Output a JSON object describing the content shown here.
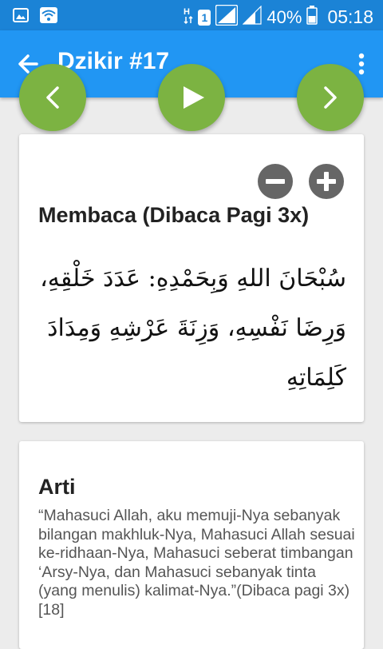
{
  "status_bar": {
    "sim_slot": "1",
    "battery_percent": "40%",
    "time": "05:18",
    "icons": [
      "image-icon",
      "wifi-icon",
      "data-icon",
      "sim-badge",
      "signal-icon",
      "signal-icon",
      "battery-icon"
    ]
  },
  "app_bar": {
    "title": "Dzikir #17",
    "back_icon": "arrow-back-icon",
    "menu_icon": "more-vert-icon"
  },
  "nav": {
    "prev_icon": "chevron-left-icon",
    "play_icon": "play-icon",
    "next_icon": "chevron-right-icon"
  },
  "reading_card": {
    "heading": "Membaca (Dibaca Pagi 3x)",
    "arabic": "سُبْحَانَ اللهِ وَبِحَمْدِهِ: عَدَدَ خَلْقِهِ، وَرِضَا نَفْسِهِ، وَزِنَةَ عَرْشِهِ وَمِدَادَ كَلِمَاتِهِ",
    "zoom_out_icon": "minus-circle-icon",
    "zoom_in_icon": "plus-circle-icon"
  },
  "arti_card": {
    "heading": "Arti",
    "text": "“Mahasuci Allah, aku memuji-Nya sebanyak bilangan makhluk-Nya, Mahasuci Allah sesuai ke-ridhaan-Nya, Mahasuci seberat timbangan ‘Arsy-Nya, dan Mahasuci sebanyak tinta (yang menulis) kalimat-Nya.”(Dibaca pagi 3x) [18]"
  },
  "colors": {
    "status_bar": "#1b83d6",
    "app_bar": "#2196f3",
    "fab": "#7cb342",
    "zoom_buttons": "#666666"
  }
}
